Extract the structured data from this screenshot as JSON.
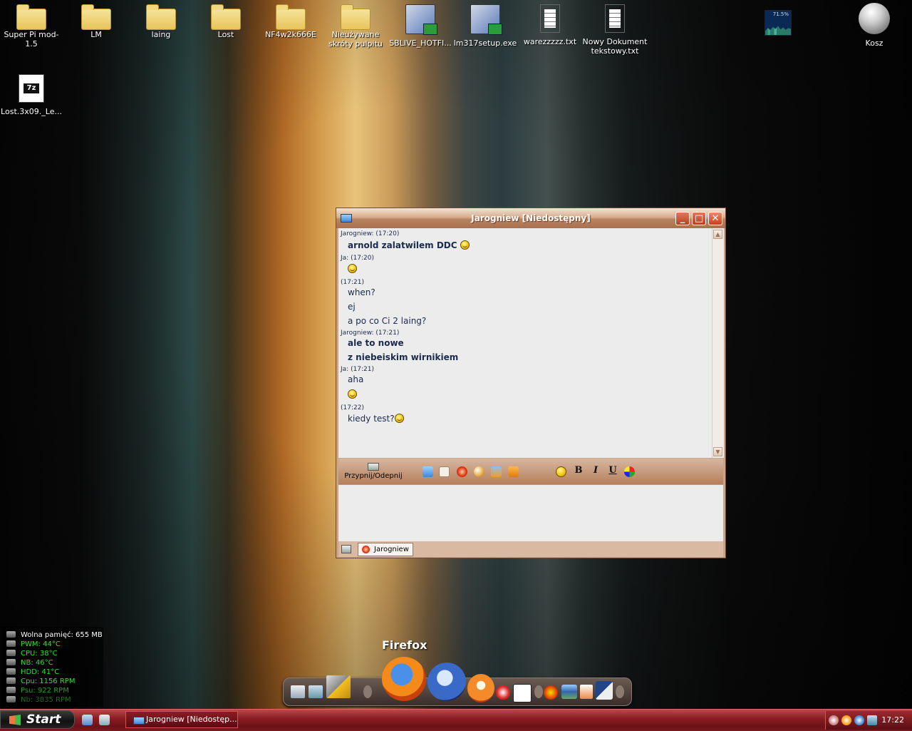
{
  "desktop": {
    "icons_row1": [
      {
        "label": "Super Pi mod-1.5",
        "icon": "folder-icon"
      },
      {
        "label": "LM",
        "icon": "folder-icon"
      },
      {
        "label": "laing",
        "icon": "folder-icon"
      },
      {
        "label": "Lost",
        "icon": "folder-icon"
      },
      {
        "label": "NF4w2k666E",
        "icon": "folder-icon"
      },
      {
        "label": "Nieużywane skróty pulpitu",
        "icon": "folder-icon"
      },
      {
        "label": "SBLIVE_HOTFI...",
        "icon": "setup-icon"
      },
      {
        "label": "lm317setup.exe",
        "icon": "setup-icon"
      },
      {
        "label": "warezzzzz.txt",
        "icon": "notepad-icon"
      },
      {
        "label": "Nowy Dokument tekstowy.txt",
        "icon": "notepad-icon"
      }
    ],
    "archive_icon": {
      "label": "Lost.3x09._Le...",
      "badge": "7z"
    },
    "recycle_bin": {
      "label": "Kosz"
    },
    "cpu_graph": {
      "percent_label": "71.5%"
    }
  },
  "chat": {
    "title": "Jarogniew [Niedostępny]",
    "messages": {
      "m1_header": "Jarogniew:  (17:20)",
      "m1_line1": "arnold zalatwilem DDC",
      "m2_header": "Ja:  (17:20)",
      "m3_header": "(17:21)",
      "m3_line1": "when?",
      "m3_line2": "ej",
      "m3_line3": "a po co Ci 2 laing?",
      "m4_header": "Jarogniew:  (17:21)",
      "m4_line1": "ale to nowe",
      "m4_line2": "z niebeiskim wirnikiem",
      "m5_header": "Ja:  (17:21)",
      "m5_line1": "aha",
      "m6_header": "(17:22)",
      "m6_line1": "kiedy test?"
    },
    "toolbar": {
      "pin_label": "Przypnij/Odepnij",
      "bold": "B",
      "italic": "I",
      "underline": "U"
    },
    "tab_label": "Jarogniew"
  },
  "sysmon": {
    "rows": [
      {
        "text": "Wolna pamięć: 655 MB",
        "color": "#ffffff"
      },
      {
        "text": "PWM: 44°C",
        "color": "#2ee02e"
      },
      {
        "text": "CPU: 38°C",
        "color": "#2ee02e"
      },
      {
        "text": "NB: 46°C",
        "color": "#2ee02e"
      },
      {
        "text": "HDD: 41°C",
        "color": "#2ee02e"
      },
      {
        "text": "Cpu: 1156 RPM",
        "color": "#2ee02e"
      },
      {
        "text": "Psu: 922 RPM",
        "color": "#2a9a2a"
      },
      {
        "text": "Nb: 3835 RPM",
        "color": "#1e6a1e"
      }
    ]
  },
  "dock": {
    "active_label": "Firefox"
  },
  "taskbar": {
    "start_label": "Start",
    "task_label": "Jarogniew [Niedostęp...",
    "clock": "17:22"
  }
}
